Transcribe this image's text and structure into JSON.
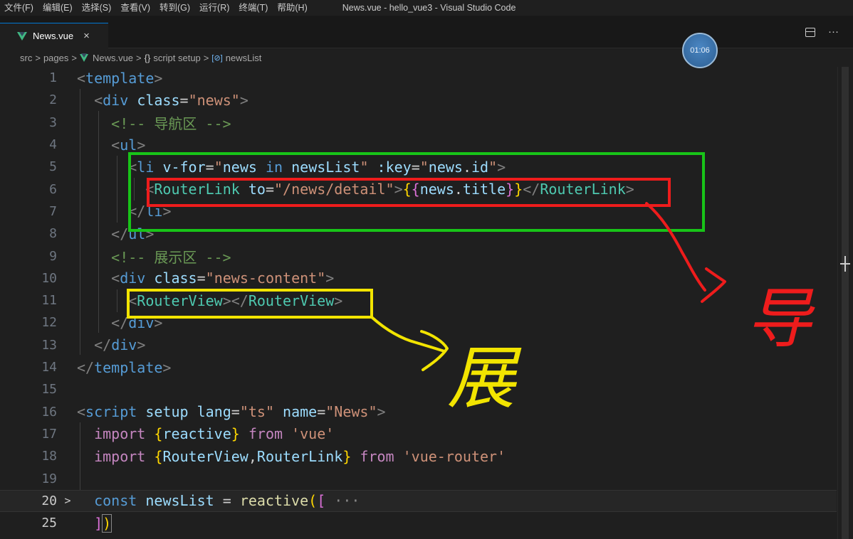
{
  "menubar": {
    "items": [
      "文件(F)",
      "编辑(E)",
      "选择(S)",
      "查看(V)",
      "转到(G)",
      "运行(R)",
      "终端(T)",
      "帮助(H)"
    ],
    "window_title": "News.vue - hello_vue3 - Visual Studio Code"
  },
  "tab": {
    "label": "News.vue",
    "close": "×"
  },
  "tab_actions": {
    "more": "···"
  },
  "timer": "01:06",
  "breadcrumb": {
    "parts": [
      "src",
      "pages",
      "News.vue",
      "script setup",
      "newsList"
    ],
    "separator": ">",
    "braces": "{}",
    "var_icon": "[⊘]"
  },
  "editor": {
    "line_numbers": [
      "1",
      "2",
      "3",
      "4",
      "5",
      "6",
      "7",
      "8",
      "9",
      "10",
      "11",
      "12",
      "13",
      "14",
      "15",
      "16",
      "17",
      "18",
      "19",
      "20",
      "25"
    ],
    "fold_marker": ">",
    "fold_ellipsis": "···"
  },
  "annotations": {
    "dao": "导",
    "zhan": "展",
    "colors": {
      "green": "#18c418",
      "red": "#ee1c1c",
      "yellow": "#f2e400"
    }
  },
  "icons": [
    "vue-icon",
    "close-icon",
    "split-editor-icon",
    "more-icon",
    "chevron-right-icon",
    "braces-icon",
    "variable-icon"
  ]
}
